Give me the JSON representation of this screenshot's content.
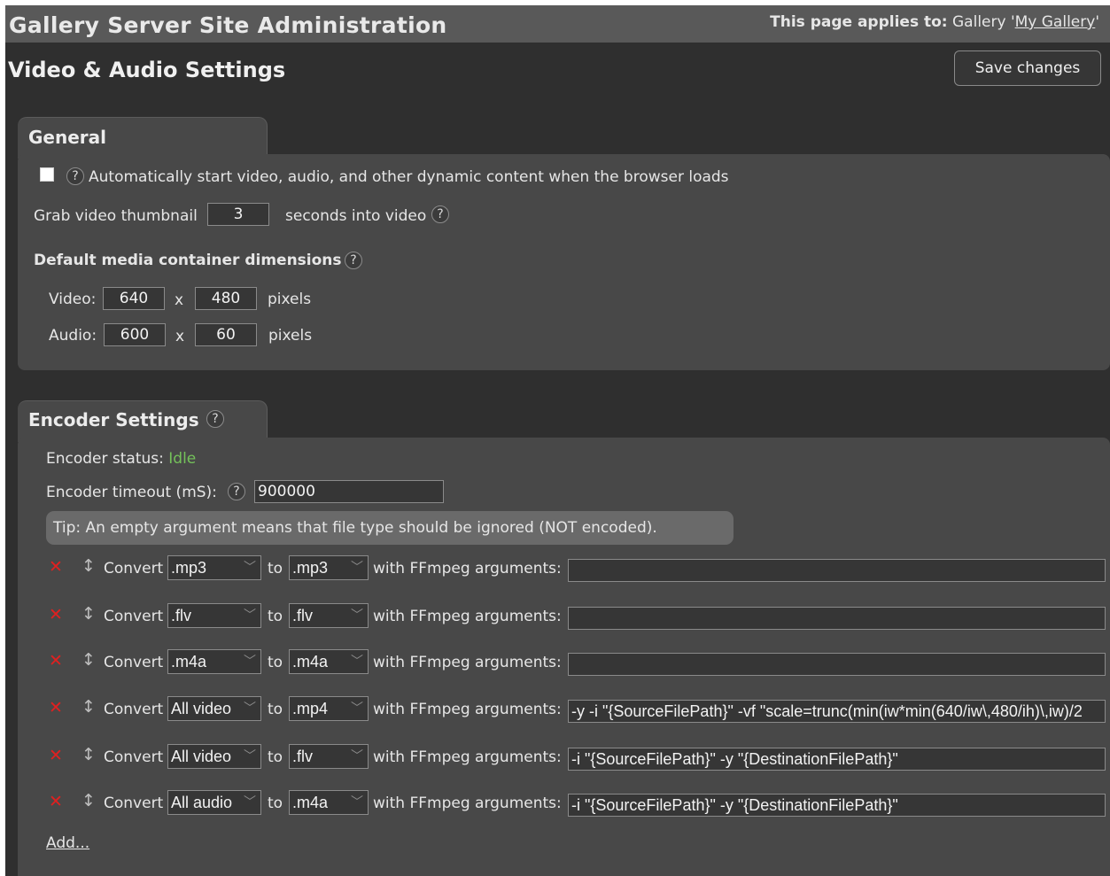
{
  "header": {
    "app_title": "Gallery Server Site Administration",
    "applies_prefix": "This page applies to:",
    "applies_gallery_word": "Gallery",
    "gallery_name": "My Gallery"
  },
  "page": {
    "title": "Video & Audio Settings",
    "save_label": "Save changes"
  },
  "general": {
    "tab_label": "General",
    "autostart_checked": false,
    "autostart_label": "Automatically start video, audio, and other dynamic content when the browser loads",
    "thumb_label": "Grab video thumbnail",
    "thumb_value": "3",
    "thumb_suffix": "seconds into video",
    "dims_heading": "Default media container dimensions",
    "video_label": "Video:",
    "video_width": "640",
    "video_height": "480",
    "audio_label": "Audio:",
    "audio_width": "600",
    "audio_height": "60",
    "x_sep": "x",
    "pixels_label": "pixels"
  },
  "encoder": {
    "tab_label": "Encoder Settings",
    "status_label": "Encoder status:",
    "status_value": "Idle",
    "status_color": "#74c15a",
    "timeout_label": "Encoder timeout (mS):",
    "timeout_value": "900000",
    "tip": "Tip: An empty argument means that file type should be ignored (NOT encoded).",
    "convert_label": "Convert",
    "to_label": "to",
    "with_label": "with FFmpeg arguments:",
    "rows": [
      {
        "from": ".mp3",
        "to": ".mp3",
        "args": ""
      },
      {
        "from": ".flv",
        "to": ".flv",
        "args": ""
      },
      {
        "from": ".m4a",
        "to": ".m4a",
        "args": ""
      },
      {
        "from": "All video",
        "to": ".mp4",
        "args": "-y -i \"{SourceFilePath}\" -vf \"scale=trunc(min(iw*min(640/iw\\,480/ih)\\,iw)/2"
      },
      {
        "from": "All video",
        "to": ".flv",
        "args": "-i \"{SourceFilePath}\" -y \"{DestinationFilePath}\""
      },
      {
        "from": "All audio",
        "to": ".m4a",
        "args": "-i \"{SourceFilePath}\" -y \"{DestinationFilePath}\""
      }
    ],
    "add_label": "Add..."
  },
  "icons": {
    "help": "question-circle-icon",
    "delete": "red-x-icon",
    "drag": "updown-arrow-icon",
    "chevron": "chevron-down-icon"
  },
  "colors": {
    "background": "#2f2f2f",
    "panel": "#484848",
    "topbar": "#595959",
    "delete": "#e02020"
  }
}
